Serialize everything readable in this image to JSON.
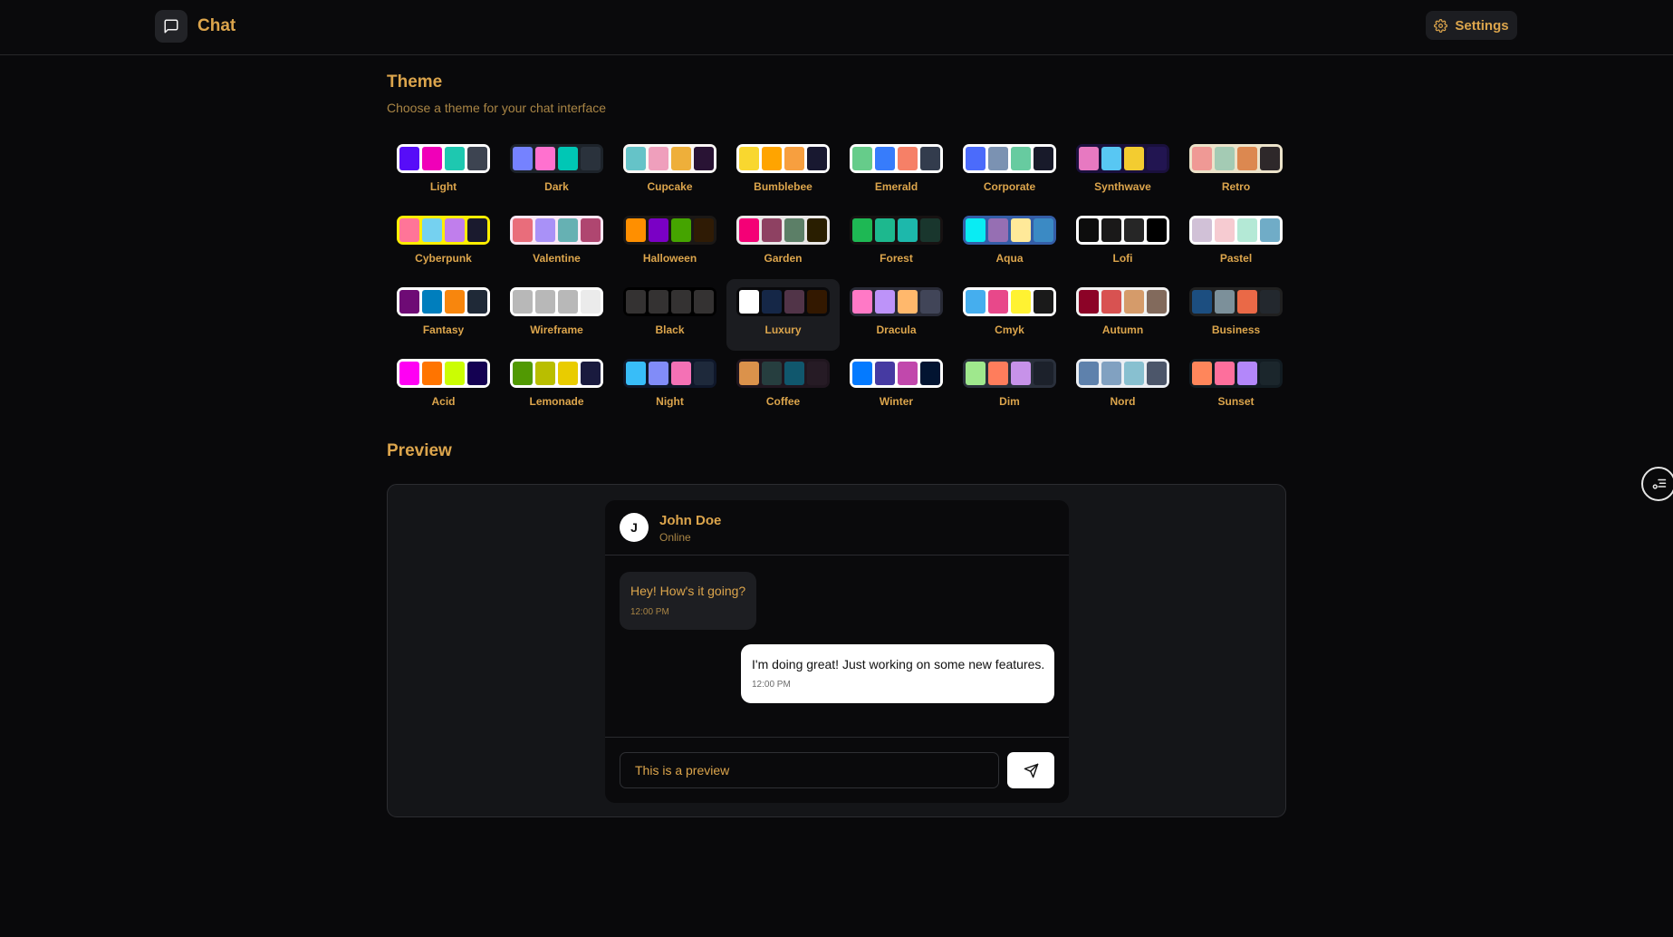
{
  "nav": {
    "title": "Chat",
    "settings_label": "Settings"
  },
  "theme_section": {
    "title": "Theme",
    "subtitle": "Choose a theme for your chat interface",
    "selected": "Luxury",
    "themes": [
      {
        "name": "Light",
        "frame": "#ffffff",
        "colors": [
          "#570df8",
          "#f000b8",
          "#1ec8b0",
          "#3d4451"
        ]
      },
      {
        "name": "Dark",
        "frame": "#1d232a",
        "colors": [
          "#7582ff",
          "#ff71cf",
          "#00c7b5",
          "#2a323c"
        ]
      },
      {
        "name": "Cupcake",
        "frame": "#faf7f5",
        "colors": [
          "#65c3c8",
          "#ef9fbc",
          "#eeaf3a",
          "#291334"
        ]
      },
      {
        "name": "Bumblebee",
        "frame": "#ffffff",
        "colors": [
          "#f9d72f",
          "#ffa400",
          "#f79f3f",
          "#181830"
        ]
      },
      {
        "name": "Emerald",
        "frame": "#ffffff",
        "colors": [
          "#66cc8a",
          "#377cfb",
          "#f68067",
          "#333c4d"
        ]
      },
      {
        "name": "Corporate",
        "frame": "#ffffff",
        "colors": [
          "#4b6bfb",
          "#7b92b2",
          "#67cba0",
          "#181a2a"
        ]
      },
      {
        "name": "Synthwave",
        "frame": "#1a103d",
        "colors": [
          "#e779c1",
          "#58c7f3",
          "#f3cc30",
          "#221551"
        ]
      },
      {
        "name": "Retro",
        "frame": "#ece3ca",
        "colors": [
          "#ef9995",
          "#a4cbb4",
          "#dc8850",
          "#2e282a"
        ]
      },
      {
        "name": "Cyberpunk",
        "frame": "#ffee00",
        "colors": [
          "#ff7598",
          "#75d1f0",
          "#c07eec",
          "#1a1a2e"
        ]
      },
      {
        "name": "Valentine",
        "frame": "#fae7f4",
        "colors": [
          "#e96d7b",
          "#a991f7",
          "#66b1b3",
          "#af4670"
        ]
      },
      {
        "name": "Halloween",
        "frame": "#1b1816",
        "colors": [
          "#ff8f00",
          "#7a00c5",
          "#45a400",
          "#2f1b05"
        ]
      },
      {
        "name": "Garden",
        "frame": "#e9e7e7",
        "colors": [
          "#f40076",
          "#8e4162",
          "#5c7f67",
          "#291e00"
        ]
      },
      {
        "name": "Forest",
        "frame": "#171212",
        "colors": [
          "#1eb854",
          "#1db88e",
          "#1db8ab",
          "#19362d"
        ]
      },
      {
        "name": "Aqua",
        "frame": "#345da7",
        "colors": [
          "#09ecf3",
          "#966fb3",
          "#ffe999",
          "#3b8ac4"
        ]
      },
      {
        "name": "Lofi",
        "frame": "#ffffff",
        "colors": [
          "#0d0d0d",
          "#1a1919",
          "#262626",
          "#000000"
        ]
      },
      {
        "name": "Pastel",
        "frame": "#ffffff",
        "colors": [
          "#d1c1d7",
          "#f6cbd1",
          "#b4e9d6",
          "#70acc7"
        ]
      },
      {
        "name": "Fantasy",
        "frame": "#ffffff",
        "colors": [
          "#6e0b75",
          "#007ebd",
          "#f8860d",
          "#1f2937"
        ]
      },
      {
        "name": "Wireframe",
        "frame": "#ffffff",
        "colors": [
          "#b8b8b8",
          "#b8b8b8",
          "#b8b8b8",
          "#ebebeb"
        ]
      },
      {
        "name": "Black",
        "frame": "#000000",
        "colors": [
          "#343232",
          "#343232",
          "#343232",
          "#343232"
        ]
      },
      {
        "name": "Luxury",
        "frame": "#09090b",
        "colors": [
          "#ffffff",
          "#152747",
          "#513448",
          "#331800"
        ]
      },
      {
        "name": "Dracula",
        "frame": "#282a36",
        "colors": [
          "#ff79c6",
          "#bd93f9",
          "#ffb86c",
          "#414558"
        ]
      },
      {
        "name": "Cmyk",
        "frame": "#ffffff",
        "colors": [
          "#45aeee",
          "#e8488a",
          "#fff232",
          "#1a1a1a"
        ]
      },
      {
        "name": "Autumn",
        "frame": "#f1f1f1",
        "colors": [
          "#8c0327",
          "#d85251",
          "#d59b6a",
          "#826a5c"
        ]
      },
      {
        "name": "Business",
        "frame": "#202020",
        "colors": [
          "#1c4e80",
          "#7c909a",
          "#ea6947",
          "#23282e"
        ]
      },
      {
        "name": "Acid",
        "frame": "#ffffff",
        "colors": [
          "#ff00f4",
          "#ff7400",
          "#cbfd03",
          "#140152"
        ]
      },
      {
        "name": "Lemonade",
        "frame": "#ffffff",
        "colors": [
          "#519903",
          "#b9be00",
          "#e9cc00",
          "#191a3e"
        ]
      },
      {
        "name": "Night",
        "frame": "#0f172a",
        "colors": [
          "#38bdf8",
          "#818cf8",
          "#f471b5",
          "#1e293b"
        ]
      },
      {
        "name": "Coffee",
        "frame": "#20161f",
        "colors": [
          "#db924b",
          "#263e3f",
          "#10576d",
          "#261b25"
        ]
      },
      {
        "name": "Winter",
        "frame": "#ffffff",
        "colors": [
          "#047aff",
          "#463aa2",
          "#c148ac",
          "#021431"
        ]
      },
      {
        "name": "Dim",
        "frame": "#2a303c",
        "colors": [
          "#9fe88d",
          "#ff7d5c",
          "#c792e9",
          "#1c212b"
        ]
      },
      {
        "name": "Nord",
        "frame": "#eceff4",
        "colors": [
          "#5e81ac",
          "#81a1c1",
          "#88c0d0",
          "#4c566a"
        ]
      },
      {
        "name": "Sunset",
        "frame": "#121c22",
        "colors": [
          "#ff865b",
          "#fd6f9c",
          "#b387fa",
          "#1b262c"
        ]
      }
    ]
  },
  "preview_section": {
    "title": "Preview",
    "contact": {
      "initial": "J",
      "name": "John Doe",
      "status": "Online"
    },
    "messages": [
      {
        "text": "Hey! How's it going?",
        "time": "12:00 PM",
        "direction": "incoming"
      },
      {
        "text": "I'm doing great! Just working on some new features.",
        "time": "12:00 PM",
        "direction": "outgoing"
      }
    ],
    "input_value": "This is a preview"
  },
  "colors": {
    "accent": "#dca54c",
    "background": "#09090b",
    "panel": "#141518"
  }
}
